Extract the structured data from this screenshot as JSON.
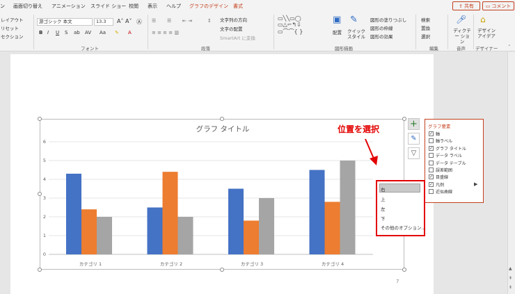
{
  "menu": {
    "tabs": [
      "ン",
      "画面切り替え",
      "アニメーション",
      "スライド ショー",
      "校閲",
      "表示",
      "ヘルプ",
      "グラフのデザイン",
      "書式"
    ],
    "share": "共有",
    "comment": "コメント"
  },
  "ribbon": {
    "slides_group": [
      "レイアウト",
      "リセット",
      "セクション"
    ],
    "font_name": "游ゴシック 本文",
    "font_size": "13.3",
    "font_group_label": "フォント",
    "paragraph_group_label": "段落",
    "text_direction": "文字列の方向",
    "text_align": "文字の配置",
    "smartart": "SmartArt に変換",
    "drawing_group_label": "図形描画",
    "arrange": "配置",
    "quick_style": "クイック スタイル",
    "shape_fill": "図形の塗りつぶし",
    "shape_outline": "図形の枠線",
    "shape_effects": "図形の効果",
    "find": "検索",
    "replace": "置換",
    "select": "選択",
    "editing_group_label": "編集",
    "dictate": "ディクテー ション",
    "voice_group_label": "音声",
    "designer": "デザイン アイデア",
    "designer_group_label": "デザイナー"
  },
  "chart": {
    "page_number": "7",
    "side_buttons": [
      "+",
      "brush",
      "filter"
    ]
  },
  "chart_data": {
    "type": "bar",
    "title": "グラフ タイトル",
    "categories": [
      "カテゴリ 1",
      "カテゴリ 2",
      "カテゴリ 3",
      "カテゴリ 4"
    ],
    "series": [
      {
        "values": [
          4.3,
          2.5,
          3.5,
          4.5
        ],
        "color": "#4472c4"
      },
      {
        "values": [
          2.4,
          4.4,
          1.8,
          2.8
        ],
        "color": "#ed7d31"
      },
      {
        "values": [
          2,
          2,
          3,
          5
        ],
        "color": "#a5a5a5"
      }
    ],
    "yticks": [
      "0",
      "1",
      "2",
      "3",
      "4",
      "5",
      "6"
    ],
    "ylim": [
      0,
      6
    ],
    "grid": true,
    "legend": "none"
  },
  "elements_panel": {
    "title": "グラフ要素",
    "items": [
      {
        "label": "軸",
        "checked": true
      },
      {
        "label": "軸ラベル",
        "checked": false
      },
      {
        "label": "グラフ タイトル",
        "checked": true
      },
      {
        "label": "データ ラベル",
        "checked": false
      },
      {
        "label": "データ テーブル",
        "checked": false
      },
      {
        "label": "誤差範囲",
        "checked": false
      },
      {
        "label": "目盛線",
        "checked": true
      },
      {
        "label": "凡例",
        "checked": true
      },
      {
        "label": "近似曲線",
        "checked": false
      }
    ]
  },
  "position_menu": {
    "items": [
      "右",
      "上",
      "左",
      "下",
      "その他のオプション..."
    ]
  },
  "annotation": "位置を選択"
}
